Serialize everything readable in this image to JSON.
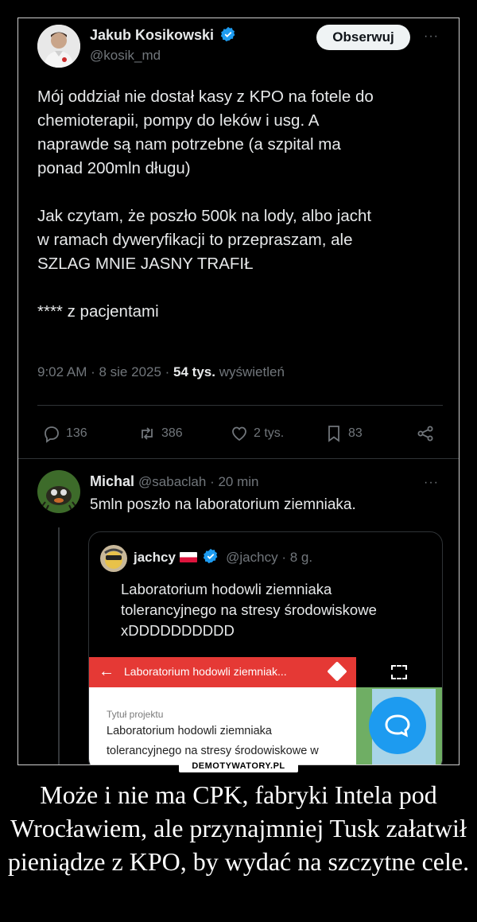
{
  "tweet": {
    "author_name": "Jakub Kosikowski",
    "author_handle": "@kosik_md",
    "follow_label": "Obserwuj",
    "more": "···",
    "body": "Mój oddział nie dostał kasy z KPO na fotele do\nchemioterapii, pompy do leków i usg. A\nnaprawde są nam potrzebne (a szpital ma\nponad 200mln długu)\n\nJak czytam, że poszło 500k na lody, albo jacht\nw ramach dyweryfikacji to przepraszam, ale\nSZLAG MNIE JASNY TRAFIŁ\n\n**** z pacjentami",
    "time": "9:02 AM · 8 sie 2025 · ",
    "views_count": "54 tys.",
    "views_label": " wyświetleń",
    "replies": "136",
    "reposts": "386",
    "likes": "2 tys.",
    "bookmarks": "83"
  },
  "reply": {
    "author_name": "Michal",
    "author_handle": "@sabaclah",
    "time": " · 20 min",
    "more": "···",
    "body": "5mln poszło na laboratorium ziemniaka."
  },
  "quote": {
    "author_name": "jachcy",
    "author_handle": "@jachcy",
    "time": " · 8 g.",
    "body": "Laboratorium hodowli ziemniaka\ntolerancyjnego na stresy środowiskowe\nxDDDDDDDDDD",
    "screenshot": {
      "header_title": "Laboratorium hodowli ziemniak...",
      "field_label": "Tytuł projektu",
      "field_value_line1": "Laboratorium hodowli ziemniaka",
      "field_value_line2": "tolerancyjnego na stresy środowiskowe w"
    }
  },
  "watermark": "DEMOTYWATORY.PL",
  "caption": "Może i nie ma CPK, fabryki Intela pod Wrocławiem, ale przynajmniej Tusk załatwił pieniądze z KPO, by wydać na szczytne cele.",
  "colors": {
    "accent": "#1d9bf0",
    "header_red": "#e53935"
  }
}
